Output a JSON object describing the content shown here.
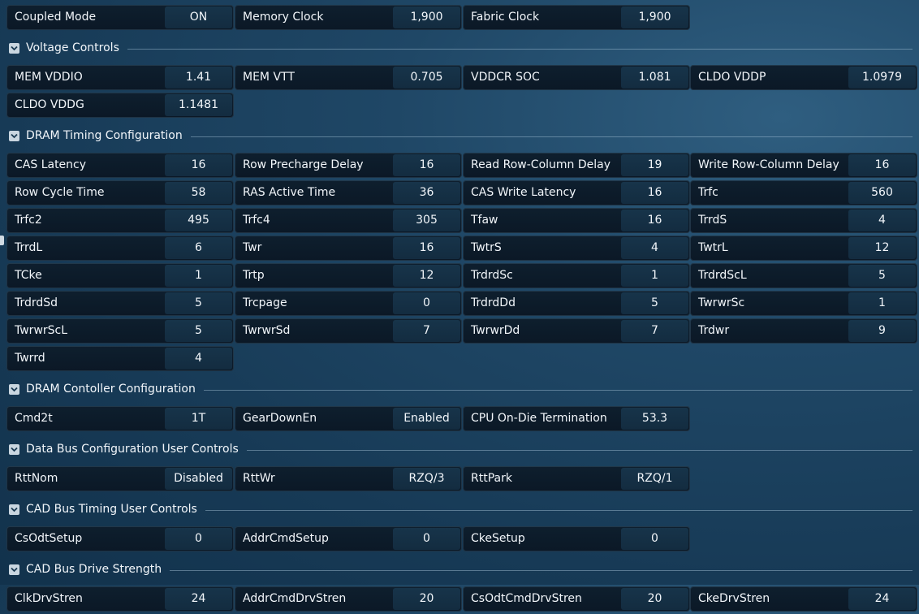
{
  "clock_settings": [
    {
      "label": "Coupled Mode",
      "value": "ON"
    },
    {
      "label": "Memory Clock",
      "value": "1,900"
    },
    {
      "label": "Fabric Clock",
      "value": "1,900"
    }
  ],
  "sections": [
    {
      "id": "voltage-controls",
      "title": "Voltage Controls",
      "rows": [
        [
          {
            "label": "MEM VDDIO",
            "value": "1.41"
          },
          {
            "label": "MEM VTT",
            "value": "0.705"
          },
          {
            "label": "VDDCR SOC",
            "value": "1.081"
          },
          {
            "label": "CLDO VDDP",
            "value": "1.0979"
          }
        ],
        [
          {
            "label": "CLDO VDDG",
            "value": "1.1481"
          }
        ]
      ]
    },
    {
      "id": "dram-timing",
      "title": "DRAM Timing Configuration",
      "rows": [
        [
          {
            "label": "CAS Latency",
            "value": "16"
          },
          {
            "label": "Row Precharge Delay",
            "value": "16"
          },
          {
            "label": "Read Row-Column Delay",
            "value": "19"
          },
          {
            "label": "Write Row-Column Delay",
            "value": "16"
          }
        ],
        [
          {
            "label": "Row Cycle Time",
            "value": "58"
          },
          {
            "label": "RAS Active Time",
            "value": "36"
          },
          {
            "label": "CAS Write Latency",
            "value": "16"
          },
          {
            "label": "Trfc",
            "value": "560"
          }
        ],
        [
          {
            "label": "Trfc2",
            "value": "495"
          },
          {
            "label": "Trfc4",
            "value": "305"
          },
          {
            "label": "Tfaw",
            "value": "16"
          },
          {
            "label": "TrrdS",
            "value": "4"
          }
        ],
        [
          {
            "label": "TrrdL",
            "value": "6"
          },
          {
            "label": "Twr",
            "value": "16"
          },
          {
            "label": "TwtrS",
            "value": "4"
          },
          {
            "label": "TwtrL",
            "value": "12"
          }
        ],
        [
          {
            "label": "TCke",
            "value": "1"
          },
          {
            "label": "Trtp",
            "value": "12"
          },
          {
            "label": "TrdrdSc",
            "value": "1"
          },
          {
            "label": "TrdrdScL",
            "value": "5"
          }
        ],
        [
          {
            "label": "TrdrdSd",
            "value": "5"
          },
          {
            "label": "Trcpage",
            "value": "0"
          },
          {
            "label": "TrdrdDd",
            "value": "5"
          },
          {
            "label": "TwrwrSc",
            "value": "1"
          }
        ],
        [
          {
            "label": "TwrwrScL",
            "value": "5"
          },
          {
            "label": "TwrwrSd",
            "value": "7"
          },
          {
            "label": "TwrwrDd",
            "value": "7"
          },
          {
            "label": "Trdwr",
            "value": "9"
          }
        ],
        [
          {
            "label": "Twrrd",
            "value": "4"
          }
        ]
      ]
    },
    {
      "id": "dram-controller",
      "title": "DRAM Contoller Configuration",
      "rows": [
        [
          {
            "label": "Cmd2t",
            "value": "1T"
          },
          {
            "label": "GearDownEn",
            "value": "Enabled"
          },
          {
            "label": "CPU On-Die Termination",
            "value": "53.3"
          }
        ]
      ]
    },
    {
      "id": "data-bus",
      "title": "Data Bus Configuration User Controls",
      "rows": [
        [
          {
            "label": "RttNom",
            "value": "Disabled"
          },
          {
            "label": "RttWr",
            "value": "RZQ/3"
          },
          {
            "label": "RttPark",
            "value": "RZQ/1"
          }
        ]
      ]
    },
    {
      "id": "cad-bus-timing",
      "title": "CAD Bus Timing User Controls",
      "rows": [
        [
          {
            "label": "CsOdtSetup",
            "value": "0"
          },
          {
            "label": "AddrCmdSetup",
            "value": "0"
          },
          {
            "label": "CkeSetup",
            "value": "0"
          }
        ]
      ]
    },
    {
      "id": "cad-bus-drive",
      "title": "CAD Bus Drive Strength",
      "rows": [
        [
          {
            "label": "ClkDrvStren",
            "value": "24"
          },
          {
            "label": "AddrCmdDrvStren",
            "value": "20"
          },
          {
            "label": "CsOdtCmdDrvStren",
            "value": "20"
          },
          {
            "label": "CkeDrvStren",
            "value": "24"
          }
        ]
      ]
    }
  ]
}
